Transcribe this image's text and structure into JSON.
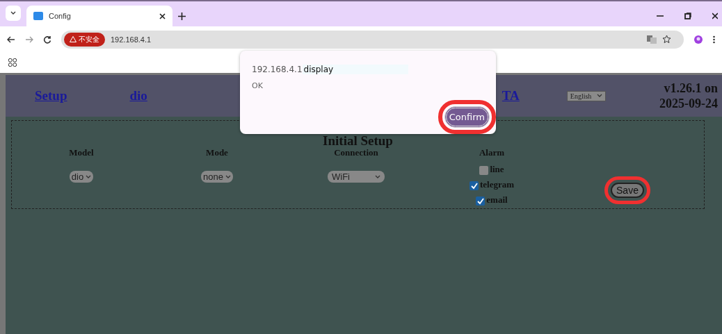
{
  "browser": {
    "tabs": [
      {
        "title": "Config",
        "selected": true
      }
    ],
    "security_badge": "不安全",
    "address": "192.168.4.1"
  },
  "header": {
    "links": [
      "Setup",
      "dio",
      "TA"
    ],
    "language": "English",
    "version_lines": [
      "v1.26.1 on",
      "2025-09-24"
    ]
  },
  "setup": {
    "title": "Initial Setup",
    "fields": [
      {
        "kind": "select",
        "label": "Model",
        "value": "dio"
      },
      {
        "kind": "select",
        "label": "Mode",
        "value": "none"
      },
      {
        "kind": "select",
        "label": "Connection",
        "value": "WiFi"
      },
      {
        "kind": "checkboxes",
        "label": "Alarm",
        "options": [
          {
            "label": "line",
            "checked": false
          },
          {
            "label": "telegram",
            "checked": true
          },
          {
            "label": "email",
            "checked": true
          }
        ]
      }
    ],
    "save": {
      "label": "Save",
      "highlighted": true
    }
  },
  "dialog": {
    "origin": "192.168.4.1",
    "message": "display",
    "body": "OK",
    "button": {
      "label": "Confirm",
      "highlighted": true
    }
  }
}
